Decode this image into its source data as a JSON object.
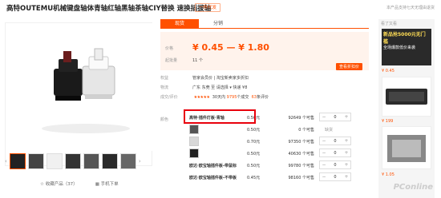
{
  "header": {
    "title": "高特OUTEMU机械键盘轴体青轴红轴黑轴茶轴CIY替换 速换插拔轴",
    "enterprise_badge": "一件代发",
    "top_note": "本产品支持七天无理由退货"
  },
  "tabs": [
    {
      "label": "现货"
    },
    {
      "label": "分销"
    }
  ],
  "price_box": {
    "price_label": "价格",
    "price_value": "¥ 0.45 — ¥ 1.80",
    "min_order_label": "起批量",
    "min_order_value": "11 个",
    "coupon_label": "查看折扣价"
  },
  "info_rows": {
    "benefit_label": "权益",
    "benefit_value": "管家会员价 | 淘宝新卖家多折扣",
    "shipping_label": "物流",
    "shipping_value": "广东 东莞 至 请选择 ▾ 快递 ¥8",
    "rating_label": "成交/评价",
    "rating_stars": "★★★★★",
    "rating_text": "30天内",
    "deals": "9795",
    "deals_unit": "个成交",
    "reviews": "63",
    "reviews_unit": "条评价"
  },
  "sku": {
    "color_label": "颜色",
    "rows": [
      {
        "name": "高特·插件灯板·青轴",
        "price": "0.50元",
        "stock": "92649 个可售",
        "qty": "0"
      },
      {
        "name": "",
        "price": "0.50元",
        "stock": "0 个可售",
        "qty": "缺货"
      },
      {
        "name": "",
        "price": "0.70元",
        "stock": "97350 个可售",
        "qty": "0"
      },
      {
        "name": "",
        "price": "0.50元",
        "stock": "40630 个可售",
        "qty": "0"
      },
      {
        "name": "欧达·欧宝轴插件板-带鼠标",
        "price": "0.50元",
        "stock": "99780 个可售",
        "qty": "0"
      },
      {
        "name": "欧达·欧宝轴插件板-不带板",
        "price": "0.45元",
        "stock": "98160 个可售",
        "qty": "0"
      }
    ],
    "out_of_stock_note": "缺货"
  },
  "image_footer": {
    "favorite": "收藏产品（37）",
    "mobile": "手机下单"
  },
  "right_bar": {
    "head": "看了又看",
    "ad_title": "新品抢5000元无门槛",
    "ad_sub": "全场爆款低价来袭",
    "prices": [
      "¥ 0.45",
      "¥ 199",
      "¥ 1.05"
    ]
  },
  "watermark": "PConline"
}
